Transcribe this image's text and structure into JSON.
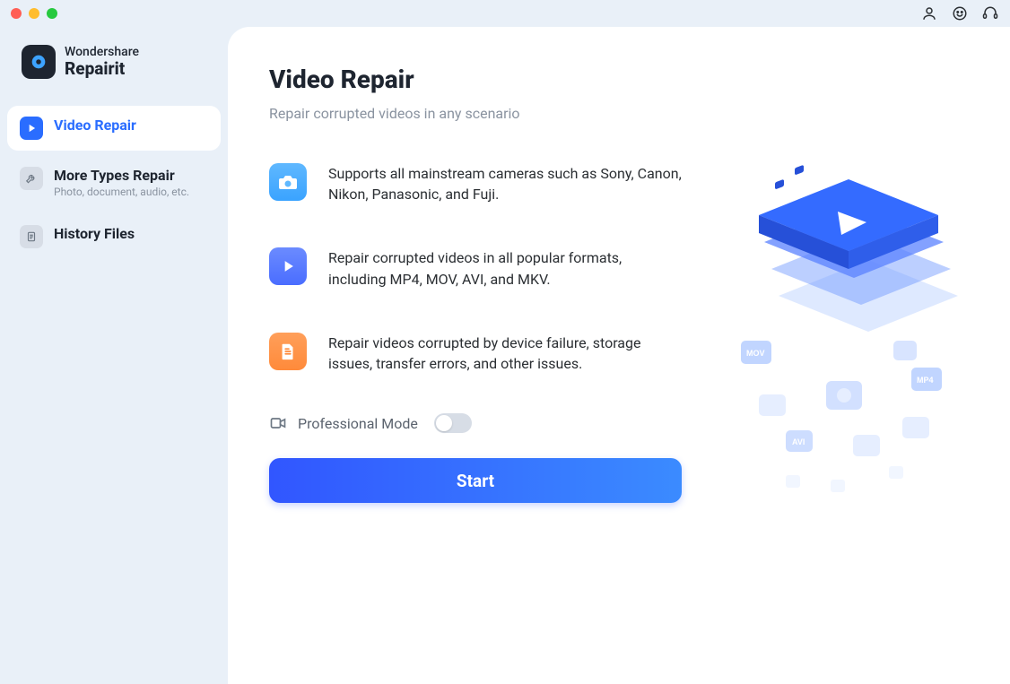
{
  "brand": {
    "line1": "Wondershare",
    "line2": "Repairit"
  },
  "sidebar": {
    "items": [
      {
        "label": "Video Repair",
        "sub": ""
      },
      {
        "label": "More Types Repair",
        "sub": "Photo, document, audio, etc."
      },
      {
        "label": "History Files",
        "sub": ""
      }
    ]
  },
  "page": {
    "title": "Video Repair",
    "subtitle": "Repair corrupted videos in any scenario"
  },
  "features": [
    "Supports all mainstream cameras such as Sony, Canon, Nikon, Panasonic, and Fuji.",
    "Repair corrupted videos in all popular formats, including MP4, MOV, AVI, and MKV.",
    "Repair videos corrupted by device failure, storage issues, transfer errors, and other issues."
  ],
  "pro_mode": {
    "label": "Professional Mode"
  },
  "buttons": {
    "start": "Start"
  }
}
